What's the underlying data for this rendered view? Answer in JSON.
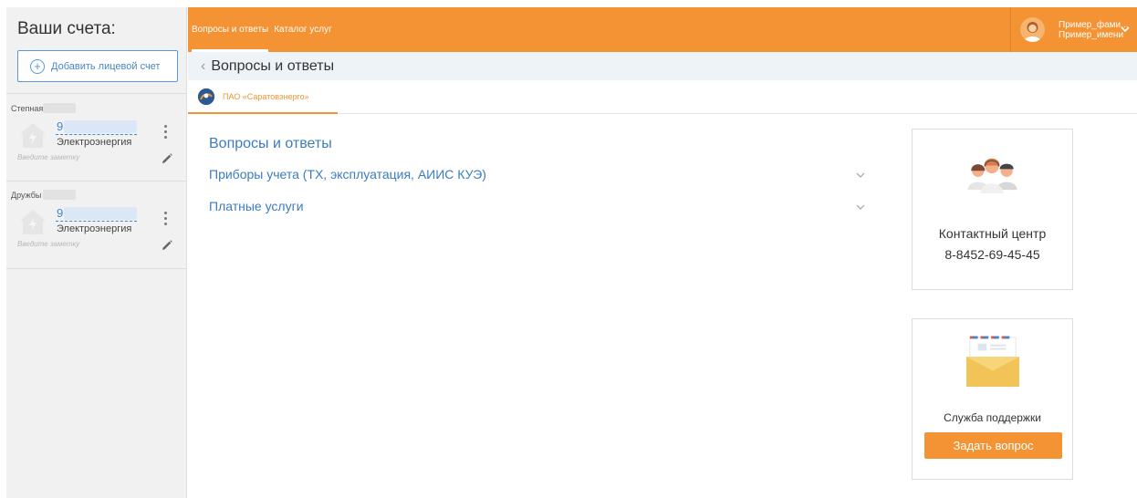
{
  "sidebar": {
    "title": "Ваши счета:",
    "add_account_label": "Добавить лицевой счет",
    "accounts": [
      {
        "address": "Степная ул.",
        "number": "9",
        "service": "Электроэнергия",
        "note_placeholder": "Введите заметку"
      },
      {
        "address": "Дружбы ул.",
        "number": "9",
        "service": "Электроэнергия",
        "note_placeholder": "Введите заметку"
      }
    ]
  },
  "topbar": {
    "nav": [
      "Вопросы и ответы",
      "Каталог услуг"
    ],
    "user": {
      "surname": "Пример_фами...",
      "name": "Пример_имени"
    }
  },
  "breadcrumb": {
    "back_icon": "chevron-left-icon",
    "title": "Вопросы и ответы"
  },
  "tabs": [
    {
      "label": "ПАО «Саратовэнерго»"
    }
  ],
  "main": {
    "heading": "Вопросы и ответы",
    "faq": [
      {
        "label": "Приборы учета (ТХ, эксплуатация, АИИС КУЭ)"
      },
      {
        "label": "Платные услуги"
      }
    ]
  },
  "contact_card": {
    "title": "Контактный центр",
    "phone": "8-8452-69-45-45"
  },
  "support_card": {
    "title": "Служба поддержки",
    "button": "Задать вопрос"
  },
  "colors": {
    "accent": "#f39334",
    "link": "#3b7cc0",
    "sidebar_bg": "#f1f1f1"
  }
}
